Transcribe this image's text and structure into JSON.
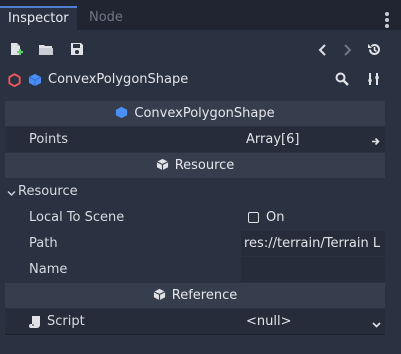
{
  "tabs": [
    {
      "label": "Inspector",
      "active": true
    },
    {
      "label": "Node",
      "active": false
    }
  ],
  "toolbar": {
    "icons": [
      "new-resource-icon",
      "open-folder-icon",
      "save-icon",
      "history-back-icon",
      "history-forward-icon",
      "object-history-icon"
    ]
  },
  "object": {
    "name": "ConvexPolygonShape",
    "icons": [
      "resource-ring-icon",
      "shape-cube-icon",
      "search-icon",
      "settings-tools-icon"
    ]
  },
  "class_header": "ConvexPolygonShape",
  "properties": {
    "points": {
      "label": "Points",
      "value": "Array[6]"
    },
    "resource_section": "Resource",
    "resource_group": "Resource",
    "local_to_scene": {
      "label": "Local To Scene",
      "value": "On",
      "checked": false
    },
    "path": {
      "label": "Path",
      "value": "res://terrain/Terrain L"
    },
    "name": {
      "label": "Name",
      "value": ""
    },
    "reference_section": "Reference",
    "script": {
      "label": "Script",
      "value": "<null>"
    }
  },
  "colors": {
    "accent": "#4d7fd0",
    "resource_icon": "#f0565b",
    "shape_icon": "#4a8ff7",
    "panel": "#2a3141",
    "background": "#202531"
  }
}
